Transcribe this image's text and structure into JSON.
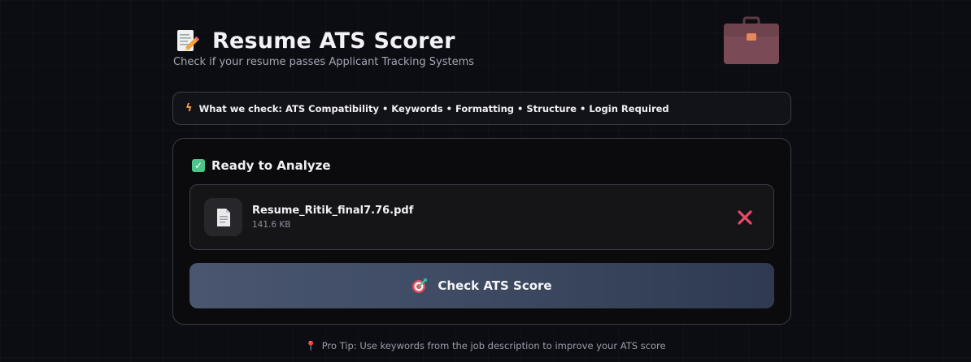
{
  "header": {
    "title": "Resume ATS Scorer",
    "subtitle": "Check if your resume passes Applicant Tracking Systems",
    "title_icon": "memo-pencil-icon",
    "decor_icon": "briefcase-icon"
  },
  "check_strip": {
    "icon": "lightning-bolt-icon",
    "text": "What we check: ATS Compatibility • Keywords • Formatting • Structure • Login Required"
  },
  "upload_card": {
    "status_label": "Ready to Analyze",
    "status_checked": true,
    "file": {
      "name": "Resume_Ritik_final7.76.pdf",
      "size": "141.6 KB",
      "icon": "document-icon",
      "remove_icon": "close-icon"
    },
    "action": {
      "label": "Check ATS Score",
      "icon": "target-icon"
    }
  },
  "tip": {
    "icon": "pushpin-icon",
    "text": "Pro Tip: Use keywords from the job description to improve your ATS score"
  },
  "colors": {
    "background": "#0c0d12",
    "accent_green": "#4cc48a",
    "close_red": "#e84a6a",
    "button_slate": "#4a5670",
    "briefcase": "#7a4a56"
  }
}
